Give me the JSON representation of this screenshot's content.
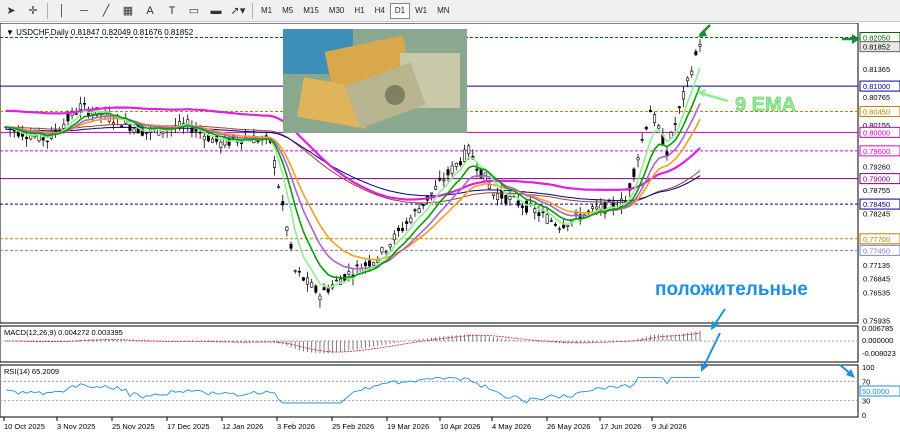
{
  "toolbar": {
    "tools": [
      "cursor-icon",
      "crosshair-icon",
      "vertical-line-icon",
      "horizontal-line-icon",
      "trendline-icon",
      "channel-icon",
      "text-icon",
      "label-icon",
      "rectangle-icon",
      "shapes-icon"
    ],
    "timeframes": [
      "M1",
      "M5",
      "M15",
      "M30",
      "H1",
      "H4",
      "D1",
      "W1",
      "MN"
    ],
    "active_timeframe": "D1"
  },
  "header": {
    "symbol": "USDCHF,Daily",
    "ohlc": "0.81847 0.82049 0.81676 0.81852"
  },
  "price_axis": {
    "labels": [
      "0.82050",
      "0.81852",
      "0.81365",
      "0.81000",
      "0.80765",
      "0.80450",
      "0.80155",
      "0.80000",
      "0.79600",
      "0.79260",
      "0.79000",
      "0.78755",
      "0.78450",
      "0.78245",
      "0.77700",
      "0.77450",
      "0.77135",
      "0.76845",
      "0.76535",
      "0.75935"
    ],
    "highlighted": [
      {
        "label": "0.82050",
        "bg": "#ffffff",
        "fg": "#006400",
        "border": "#006400"
      },
      {
        "label": "0.81852",
        "bg": "#e8e8e8",
        "fg": "#000000",
        "border": "#606060"
      },
      {
        "label": "0.81000",
        "bg": "#ffffff",
        "fg": "#0000a0",
        "border": "#0000a0"
      },
      {
        "label": "0.80450",
        "bg": "#ffffff",
        "fg": "#c08000",
        "border": "#c08000"
      },
      {
        "label": "0.80000",
        "bg": "#ffffff",
        "fg": "#c000c0",
        "border": "#c000c0"
      },
      {
        "label": "0.79600",
        "bg": "#ffffff",
        "fg": "#e000e0",
        "border": "#e000e0"
      },
      {
        "label": "0.79000",
        "bg": "#ffffff",
        "fg": "#800080",
        "border": "#800080"
      },
      {
        "label": "0.78450",
        "bg": "#ffffff",
        "fg": "#000080",
        "border": "#000080"
      },
      {
        "label": "0.77700",
        "bg": "#ffffff",
        "fg": "#c08000",
        "border": "#c08000"
      },
      {
        "label": "0.77450",
        "bg": "#ffffff",
        "fg": "#8080c0",
        "border": "#8080c0"
      }
    ]
  },
  "date_axis": [
    "10 Oct 2025",
    "3 Nov 2025",
    "25 Nov 2025",
    "17 Dec 2025",
    "12 Jan 2026",
    "3 Feb 2026",
    "25 Feb 2026",
    "19 Mar 2026",
    "10 Apr 2026",
    "4 May 2026",
    "26 May 2026",
    "17 Jun 2026",
    "9 Jul 2026"
  ],
  "macd": {
    "label": "MACD(12,26,9) 0.004272 0.003395",
    "axis": [
      "0.006785",
      "0.000000",
      "-0.008023"
    ]
  },
  "rsi": {
    "label": "RSI(14) 65.2009",
    "axis": [
      "100",
      "70",
      "50",
      "30",
      "0"
    ],
    "current": "50.0000"
  },
  "annotations": {
    "ema_label": "9 EMA",
    "positive_label": "положительные"
  },
  "colors": {
    "ema_green": "#00a000",
    "ema_light_green": "#90ee90",
    "ma_orange": "#f0a020",
    "ma_magenta": "#e020e0",
    "ma_purple": "#b060d0",
    "ma_brown": "#a04030",
    "ma_navy": "#000080",
    "candle": "#000000",
    "annotation_blue": "#1e90e0"
  }
}
